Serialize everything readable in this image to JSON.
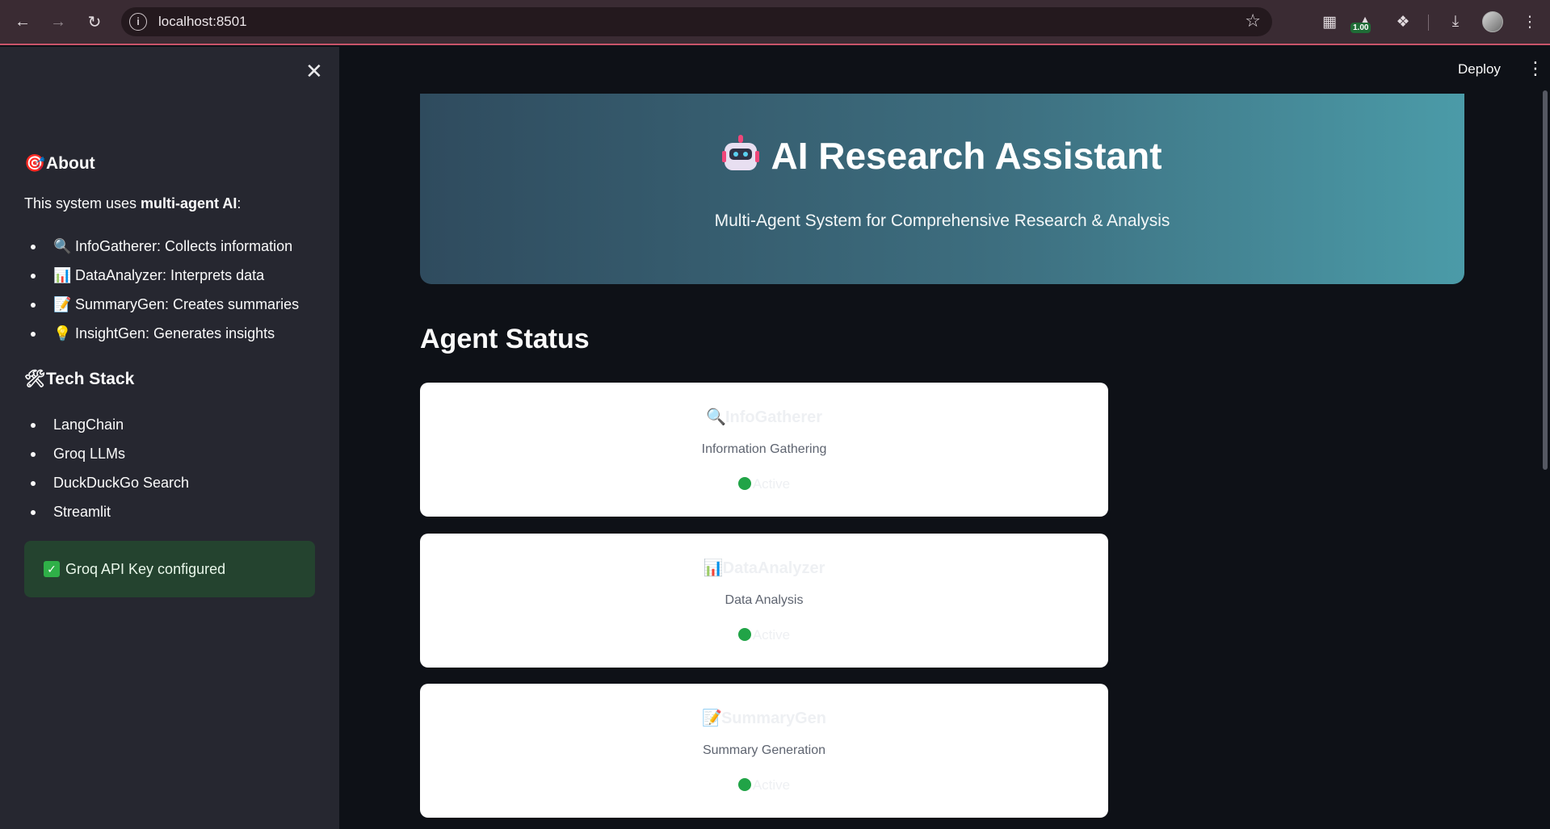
{
  "browser": {
    "url": "localhost:8501",
    "extension_badge": "1.00"
  },
  "sidebar": {
    "about_heading": "About",
    "about_intro_prefix": "This system uses ",
    "about_intro_bold": "multi-agent AI",
    "about_intro_suffix": ":",
    "agents": [
      {
        "icon": "🔍",
        "text": "InfoGatherer: Collects information"
      },
      {
        "icon": "📊",
        "text": "DataAnalyzer: Interprets data"
      },
      {
        "icon": "📝",
        "text": "SummaryGen: Creates summaries"
      },
      {
        "icon": "💡",
        "text": "InsightGen: Generates insights"
      }
    ],
    "tech_heading": "Tech Stack",
    "tech": [
      "LangChain",
      "Groq LLMs",
      "DuckDuckGo Search",
      "Streamlit"
    ],
    "api_status": "Groq API Key configured"
  },
  "header": {
    "deploy_label": "Deploy"
  },
  "hero": {
    "title": "AI Research Assistant",
    "subtitle": "Multi-Agent System for Comprehensive Research & Analysis"
  },
  "agent_status": {
    "title": "Agent Status",
    "cards": [
      {
        "icon": "🔍",
        "name": "InfoGatherer",
        "role": "Information Gathering",
        "status": "Active"
      },
      {
        "icon": "📊",
        "name": "DataAnalyzer",
        "role": "Data Analysis",
        "status": "Active"
      },
      {
        "icon": "📝",
        "name": "SummaryGen",
        "role": "Summary Generation",
        "status": "Active"
      }
    ]
  }
}
